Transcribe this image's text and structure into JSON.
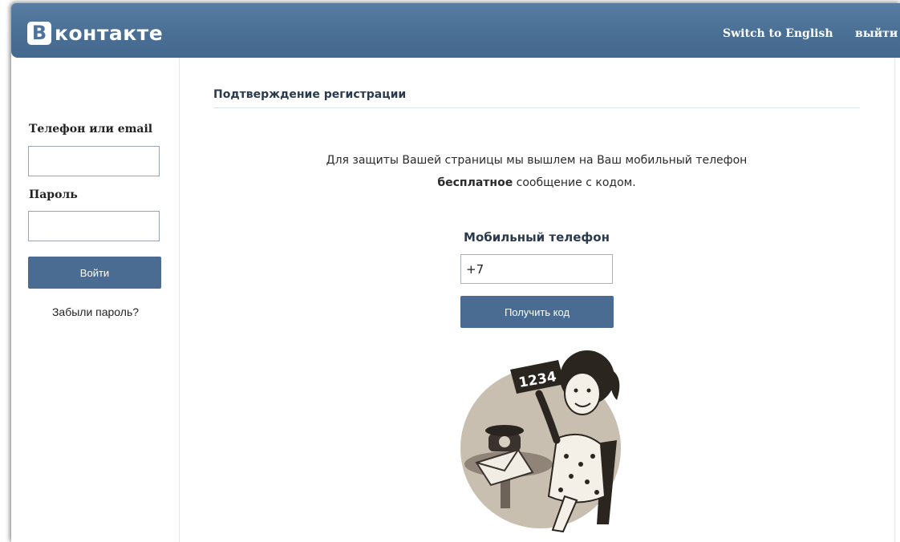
{
  "header": {
    "logo_letter": "В",
    "logo_text": "контакте",
    "switch_language": "Switch to English",
    "logout": "выйти",
    "color": "#4a6f95"
  },
  "sidebar": {
    "phone_label": "Телефон или email",
    "phone_value": "",
    "password_label": "Пароль",
    "password_value": "",
    "login_button": "Войти",
    "forgot_password": "Забыли пароль?"
  },
  "main": {
    "title": "Подтверждение регистрации",
    "info_line1": "Для защиты Вашей страницы мы вышлем на Ваш мобильный телефон",
    "info_bold": "бесплатное",
    "info_line2_rest": " сообщение с кодом.",
    "mobile_label": "Мобильный телефон",
    "mobile_value": "+7",
    "get_code_button": "Получить код",
    "illustration": {
      "icon": "woman-with-code-sign-illustration",
      "sign_text": "1234"
    }
  },
  "colors": {
    "button": "#4a6b92",
    "title_text": "#2b3a4c"
  }
}
